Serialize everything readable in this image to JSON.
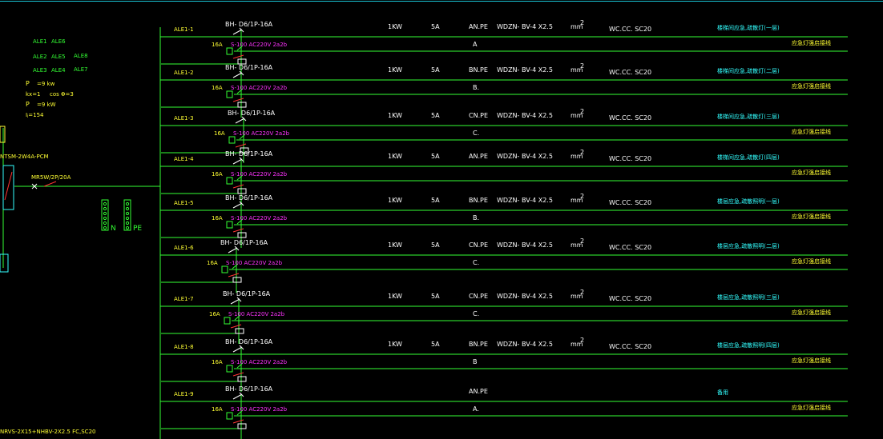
{
  "panel": {
    "ale_grid": [
      "ALE1",
      "ALE6",
      "ALE2",
      "ALE5",
      "ALE8",
      "ALE3",
      "ALE4",
      "ALE7"
    ],
    "pe_label": "P",
    "pe_value": "=9 kw",
    "kx_label": "kx=1",
    "cos_label": "cos Φ=3",
    "pjs_label": "P",
    "pjs_value": "=9 kW",
    "ijs_label": "Iⱼ=154",
    "main_switch": "NTSM-2W4A-PCM",
    "feed_switch": "MR5W/2P/20A",
    "cable": "NRVS-2X15+NHBV-2X2.5  FC,SC20",
    "n_label": "N",
    "pe_bus_label": "PE"
  },
  "circuits": [
    {
      "id": "ALE1-1",
      "breaker": "BH- D6/1P-16A",
      "current": "16A",
      "relay": "S-100 AC220V 2a2b",
      "power": "1KW",
      "amps": "5A",
      "phase_pe": "AN.PE",
      "cable": "WDZN-  BV-4 X2.5",
      "unit": "mm",
      "sup": "2",
      "install": "WC.CC.  SC20",
      "desc": "楼梯间应急,疏散灯(一层)",
      "phase": "A",
      "note": "应急灯强启接线"
    },
    {
      "id": "ALE1-2",
      "breaker": "BH- D6/1P-16A",
      "current": "16A",
      "relay": "S-100 AC220V 2a2b",
      "power": "1KW",
      "amps": "5A",
      "phase_pe": "BN.PE",
      "cable": "WDZN-  BV-4 X2.5",
      "unit": "mm",
      "sup": "2",
      "install": "WC.CC.  SC20",
      "desc": "楼梯间应急,疏散灯(二层)",
      "phase": "B.",
      "note": "应急灯强启接线"
    },
    {
      "id": "ALE1-3",
      "breaker": "BH- D6/1P-16A",
      "current": "16A",
      "relay": "S-100 AC220V 2a2b",
      "power": "1KW",
      "amps": "5A",
      "phase_pe": "CN.PE",
      "cable": "WDZN-  BV-4 X2.5",
      "unit": "mm",
      "sup": "2",
      "install": "WC.CC.  SC20",
      "desc": "楼梯间应急,疏散灯(三层)",
      "phase": "C.",
      "note": "应急灯强启接线"
    },
    {
      "id": "ALE1-4",
      "breaker": "BH- D6/1P-16A",
      "current": "16A",
      "relay": "S-100 AC220V 2a2b",
      "power": "1KW",
      "amps": "5A",
      "phase_pe": "AN.PE",
      "cable": "WDZN-  BV-4 X2.5",
      "unit": "mm",
      "sup": "2",
      "install": "WC.CC.  SC20",
      "desc": "楼梯间应急,疏散灯(四层)",
      "phase": "",
      "note": "应急灯强启接线"
    },
    {
      "id": "ALE1-5",
      "breaker": "BH- D6/1P-16A",
      "current": "16A",
      "relay": "S-100 AC220V 2a2b",
      "power": "1KW",
      "amps": "5A",
      "phase_pe": "BN.PE",
      "cable": "WDZN-  BV-4 X2.5",
      "unit": "mm",
      "sup": "2",
      "install": "WC.CC.  SC20",
      "desc": "楼层应急,疏散照明(一层)",
      "phase": "B.",
      "note": "应急灯强启接线"
    },
    {
      "id": "ALE1-6",
      "breaker": "BH- D6/1P-16A",
      "current": "16A",
      "relay": "S-100 AC220V 2a2b",
      "power": "1KW",
      "amps": "5A",
      "phase_pe": "CN.PE",
      "cable": "WDZN-  BV-4 X2.5",
      "unit": "mm",
      "sup": "2",
      "install": "WC.CC.  SC20",
      "desc": "楼层应急,疏散照明(二层)",
      "phase": "C.",
      "note": "应急灯强启接线"
    },
    {
      "id": "ALE1-7",
      "breaker": "BH- D6/1P-16A",
      "current": "16A",
      "relay": "S-100 AC220V 2a2b",
      "power": "1KW",
      "amps": "5A",
      "phase_pe": "CN.PE",
      "cable": "WDZN-  BV-4 X2.5",
      "unit": "mm",
      "sup": "2",
      "install": "WC.CC.  SC20",
      "desc": "楼层应急,疏散照明(三层)",
      "phase": "C.",
      "note": "应急灯强启接线"
    },
    {
      "id": "ALE1-8",
      "breaker": "BH- D6/1P-16A",
      "current": "16A",
      "relay": "S-100 AC220V 2a2b",
      "power": "1KW",
      "amps": "5A",
      "phase_pe": "BN.PE",
      "cable": "WDZN-  BV-4 X2.5",
      "unit": "mm",
      "sup": "2",
      "install": "WC.CC.  SC20",
      "desc": "楼层应急,疏散照明(四层)",
      "phase": "B",
      "note": "应急灯强启接线"
    },
    {
      "id": "ALE1-9",
      "breaker": "BH- D6/1P-16A",
      "current": "16A",
      "relay": "S-100 AC220V 2a2b",
      "power": "",
      "amps": "",
      "phase_pe": "AN.PE",
      "cable": "",
      "unit": "",
      "sup": "",
      "install": "",
      "desc": "备用",
      "phase": "A.",
      "note": "应急灯强启接线"
    }
  ],
  "colors": {
    "wire": "#33ff33",
    "text": "#ffffff",
    "label": "#ffff33",
    "relay": "#ff33ff",
    "desc": "#33ffff"
  }
}
